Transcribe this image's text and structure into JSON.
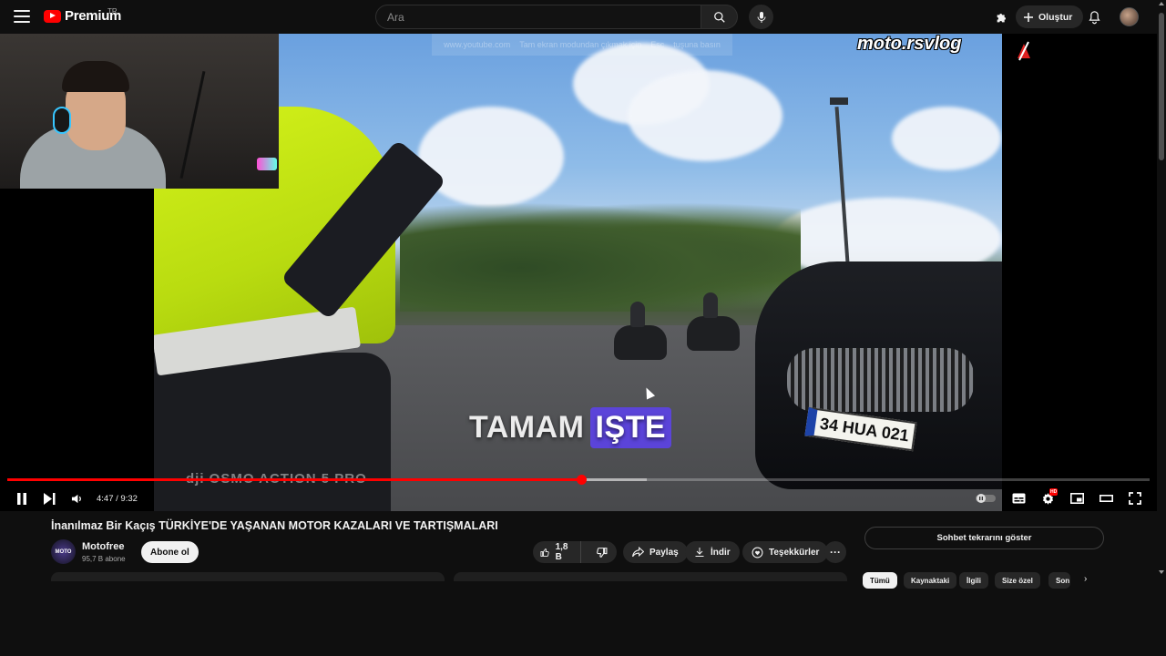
{
  "masthead": {
    "logo_text": "Premium",
    "country_code": "TR",
    "search_placeholder": "Ara",
    "create_label": "Oluştur"
  },
  "player": {
    "current_time": "4:47",
    "duration": "9:32",
    "time_display": "4:47 / 9:32",
    "progress_fraction": 0.502,
    "buffered_fraction": 0.56,
    "quality_badge": "HD",
    "video_overlay": {
      "caption_word1": "TAMAM",
      "caption_word2": "IŞTE",
      "watermark": "moto.rsvlog",
      "plate_text": "34 HUA 021",
      "camera_brand": "OSMO ACTION 5 PRO",
      "camera_logo": "dji",
      "faded_bar": [
        "www.youtube.com",
        "Tam ekran modundan çıkmak için",
        "Esc",
        "tuşuna basın"
      ]
    }
  },
  "video_info": {
    "title": "İnanılmaz Bir Kaçış TÜRKİYE'DE YAŞANAN MOTOR KAZALARI VE TARTIŞMALARI",
    "channel_name": "Motofree",
    "channel_avatar_text": "MOTO",
    "subscribers": "95,7 B abone",
    "subscribe_label": "Abone ol",
    "like_count": "1,8 B",
    "share_label": "Paylaş",
    "download_label": "İndir",
    "thanks_label": "Teşekkürler"
  },
  "sidebar": {
    "chat_button_label": "Sohbet tekrarını göster",
    "chips": [
      "Tümü",
      "Kaynaktaki",
      "İlgili",
      "Size özel",
      "Son"
    ]
  },
  "colors": {
    "progress_played": "#ff0000",
    "background": "#0f0f0f",
    "caption_highlight": "#5b44d9"
  }
}
